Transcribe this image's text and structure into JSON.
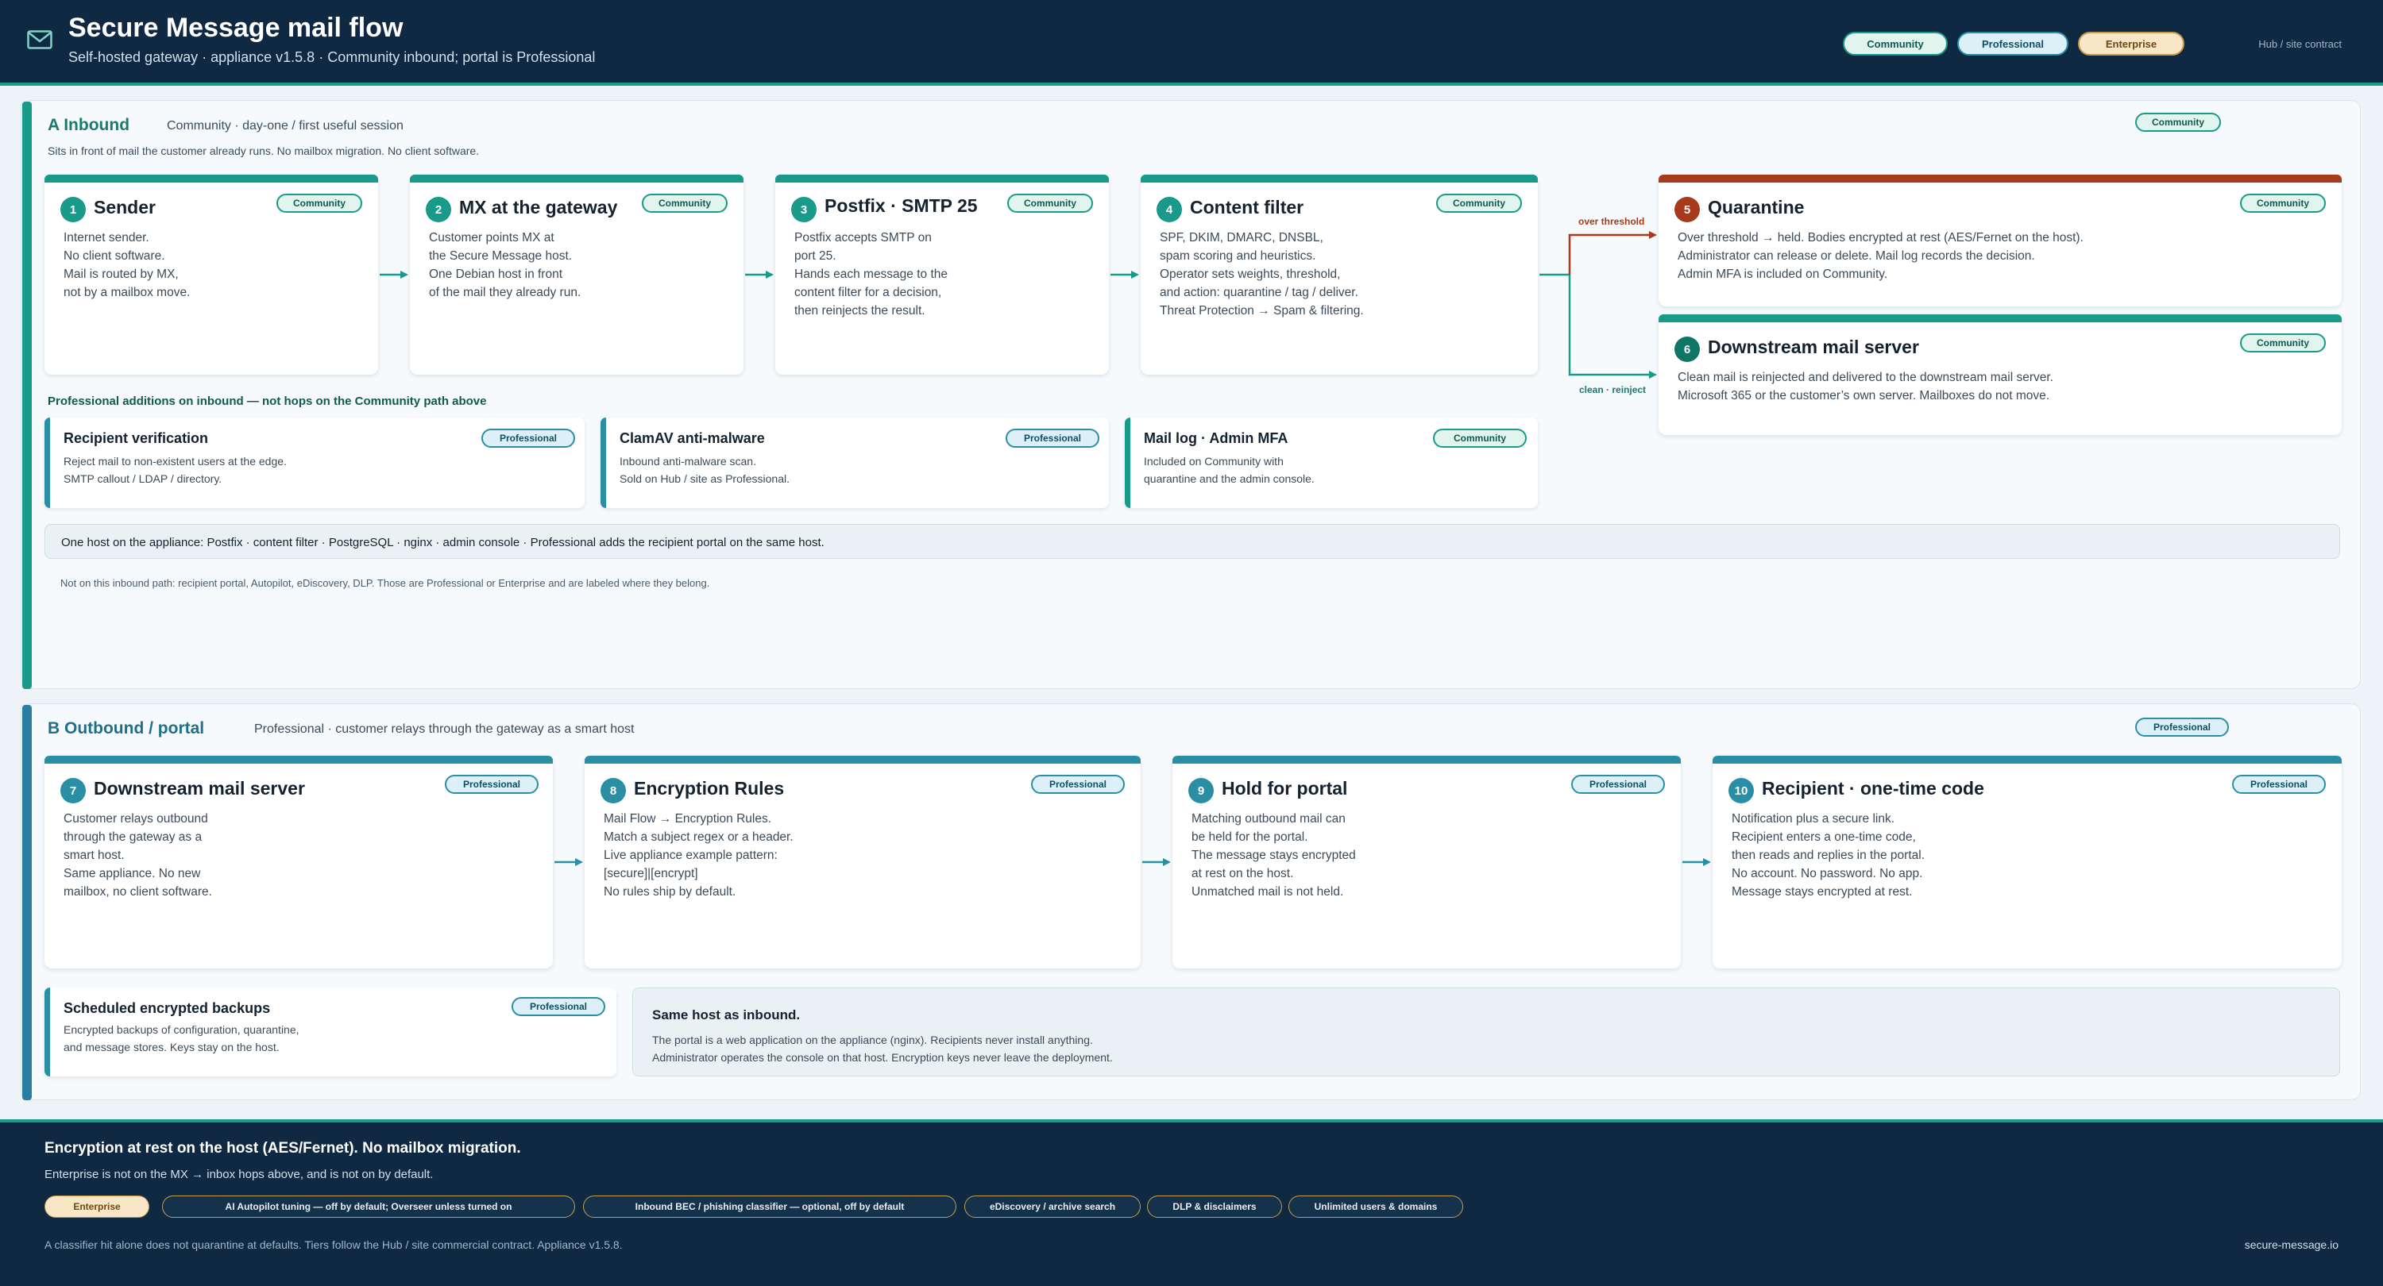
{
  "header": {
    "title": "Secure Message mail flow",
    "subtitle": "Self-hosted gateway · appliance v1.5.8 · Community inbound; portal is Professional",
    "tiers": [
      "Community",
      "Professional",
      "Enterprise"
    ],
    "right_note": "Hub / site contract",
    "icon": "mail-icon"
  },
  "colors": {
    "navy": "#0f2942",
    "teal": "#1a9a8a",
    "blue": "#2a8fa5",
    "red": "#a83a1c",
    "gold": "#c79a4c"
  },
  "inbound": {
    "title": "A Inbound",
    "subtitle": "Community · day-one / first useful session",
    "description": "Sits in front of mail the customer already runs. No mailbox migration. No client software.",
    "tier": "Community",
    "cards": [
      {
        "num": "1",
        "title": "Sender",
        "tier": "Community",
        "lines": [
          "Internet sender.",
          "No client software.",
          "Mail is routed by MX,",
          "not by a mailbox move."
        ]
      },
      {
        "num": "2",
        "title": "MX at the gateway",
        "tier": "Community",
        "lines": [
          "Customer points MX at",
          "the Secure Message host.",
          "One Debian host in front",
          "of the mail they already run."
        ]
      },
      {
        "num": "3",
        "title": "Postfix · SMTP 25",
        "tier": "Community",
        "lines": [
          "Postfix accepts SMTP on",
          "port 25.",
          "Hands each message to the",
          "content filter for a decision,",
          "then reinjects the result."
        ]
      },
      {
        "num": "4",
        "title": "Content filter",
        "tier": "Community",
        "lines": [
          "SPF, DKIM, DMARC, DNSBL,",
          "spam scoring and heuristics.",
          "Operator sets weights, threshold,",
          "and action: quarantine / tag / deliver.",
          "Threat Protection → Spam & filtering."
        ]
      },
      {
        "num": "5",
        "title": "Quarantine",
        "tier": "Community",
        "lines": [
          "Over threshold → held. Bodies encrypted at rest (AES/Fernet on the host).",
          "Administrator can release or delete. Mail log records the decision.",
          "Admin MFA is included on Community."
        ]
      },
      {
        "num": "6",
        "title": "Downstream mail server",
        "tier": "Community",
        "lines": [
          "Clean mail is reinjected and delivered to the downstream mail server.",
          "Microsoft 365 or the customer’s own server. Mailboxes do not move."
        ]
      }
    ],
    "branch_labels": {
      "over": "over threshold",
      "clean": "clean · reinject"
    },
    "additions_heading": "Professional additions on inbound — not hops on the Community path above",
    "additions": [
      {
        "title": "Recipient verification",
        "tier": "Professional",
        "lines": [
          "Reject mail to non-existent users at the edge.",
          "SMTP callout / LDAP / directory."
        ]
      },
      {
        "title": "ClamAV anti-malware",
        "tier": "Professional",
        "lines": [
          "Inbound anti-malware scan.",
          "Sold on Hub / site as Professional."
        ]
      },
      {
        "title": "Mail log · Admin MFA",
        "tier": "Community",
        "lines": [
          "Included on Community with",
          "quarantine and the admin console."
        ]
      }
    ],
    "host_note": "One host on the appliance: Postfix · content filter · PostgreSQL · nginx · admin console · Professional adds the recipient portal on the same host.",
    "not_on_path": "Not on this inbound path: recipient portal, Autopilot, eDiscovery, DLP. Those are Professional or Enterprise and are labeled where they belong."
  },
  "outbound": {
    "title": "B Outbound / portal",
    "subtitle": "Professional · customer relays through the gateway as a smart host",
    "tier": "Professional",
    "cards": [
      {
        "num": "7",
        "title": "Downstream mail server",
        "tier": "Professional",
        "lines": [
          "Customer relays outbound",
          "through the gateway as a",
          "smart host.",
          "Same appliance. No new",
          "mailbox, no client software."
        ]
      },
      {
        "num": "8",
        "title": "Encryption Rules",
        "tier": "Professional",
        "lines": [
          "Mail Flow → Encryption Rules.",
          "Match a subject regex or a header.",
          "Live appliance example pattern:",
          "[secure]|[encrypt]",
          "No rules ship by default."
        ]
      },
      {
        "num": "9",
        "title": "Hold for portal",
        "tier": "Professional",
        "lines": [
          "Matching outbound mail can",
          "be held for the portal.",
          "The message stays encrypted",
          "at rest on the host.",
          "Unmatched mail is not held."
        ]
      },
      {
        "num": "10",
        "title": "Recipient · one-time code",
        "tier": "Professional",
        "lines": [
          "Notification plus a secure link.",
          "Recipient enters a one-time code,",
          "then reads and replies in the portal.",
          "No account. No password. No app.",
          "Message stays encrypted at rest."
        ]
      }
    ],
    "backups": {
      "title": "Scheduled encrypted backups",
      "tier": "Professional",
      "lines": [
        "Encrypted backups of configuration, quarantine,",
        "and message stores. Keys stay on the host."
      ]
    },
    "same_host": {
      "title": "Same host as inbound.",
      "lines": [
        "The portal is a web application on the appliance (nginx). Recipients never install anything.",
        "Administrator operates the console on that host. Encryption keys never leave the deployment."
      ]
    }
  },
  "footer": {
    "title": "Encryption at rest on the host (AES/Fernet). No mailbox migration.",
    "subtitle": "Enterprise is not on the MX → inbox hops above, and is not on by default.",
    "tier": "Enterprise",
    "features": [
      "AI Autopilot tuning — off by default; Overseer unless turned on",
      "Inbound BEC / phishing classifier — optional, off by default",
      "eDiscovery / archive search",
      "DLP & disclaimers",
      "Unlimited users & domains"
    ],
    "note": "A classifier hit alone does not quarantine at defaults. Tiers follow the Hub / site commercial contract. Appliance v1.5.8.",
    "url": "secure-message.io"
  }
}
